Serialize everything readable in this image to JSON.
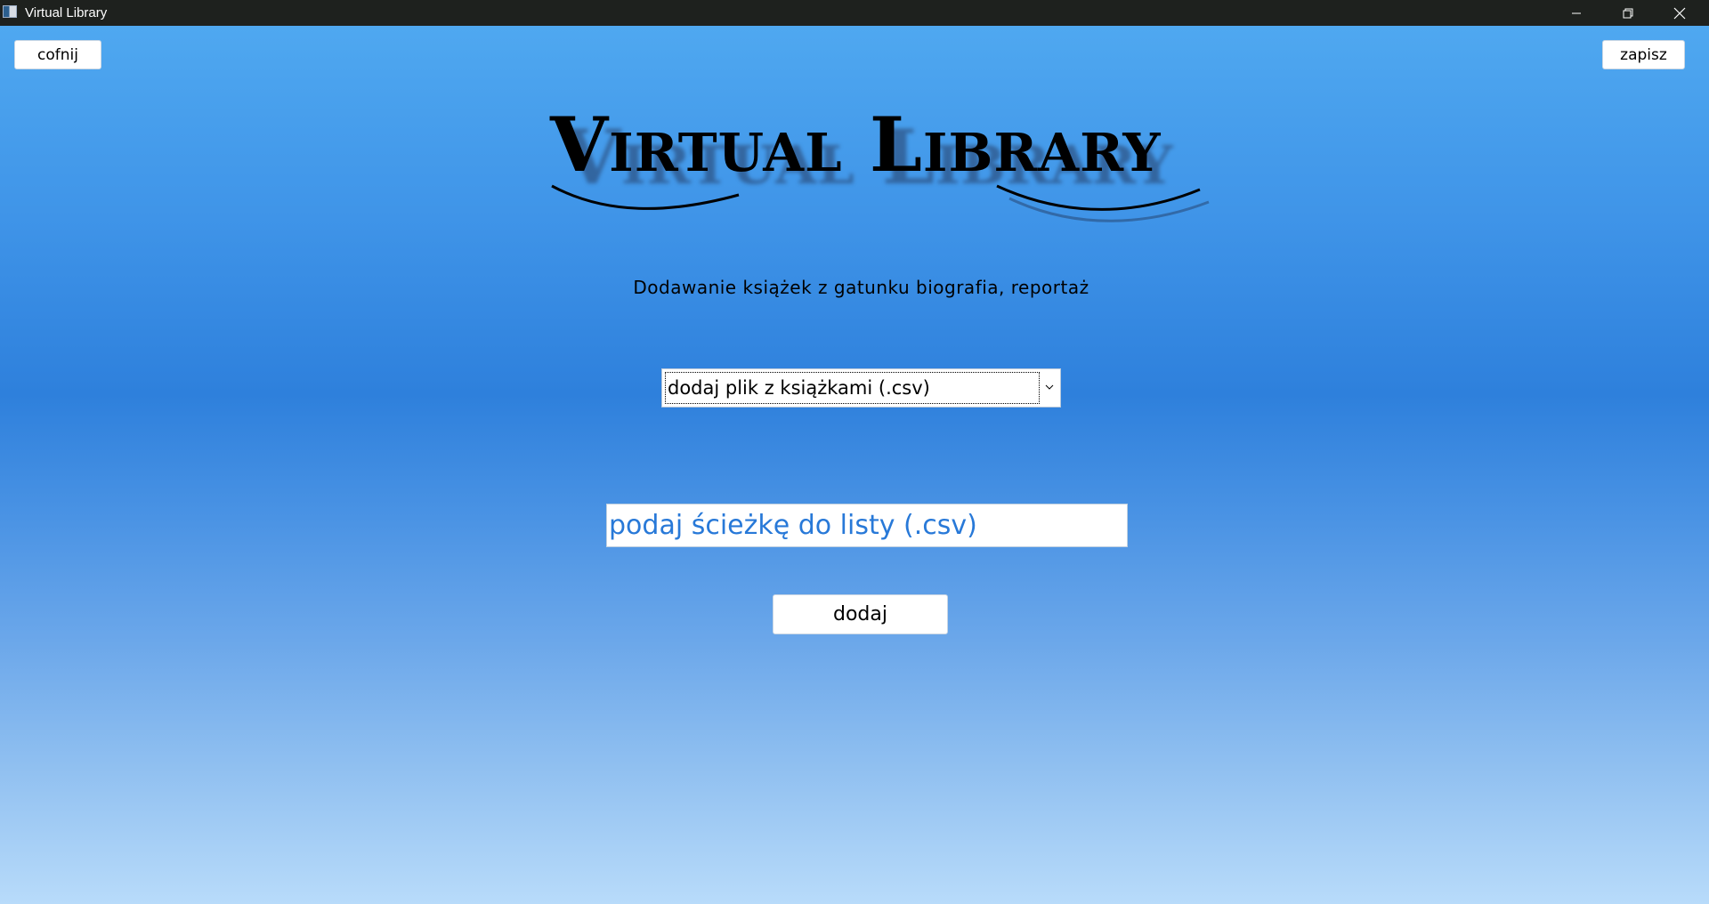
{
  "window": {
    "title": "Virtual Library",
    "controls": [
      "minimize-icon",
      "restore-icon",
      "close-icon"
    ]
  },
  "header": {
    "back_label": "cofnij",
    "save_label": "zapisz",
    "logo_text": "Virtual Library"
  },
  "main": {
    "subtitle": "Dodawanie książek z gatunku biografia, reportaż",
    "source_select": {
      "selected": "dodaj plik z książkami (.csv)"
    },
    "path_input": {
      "value": "",
      "placeholder": "podaj ścieżkę do listy (.csv)"
    },
    "add_label": "dodaj"
  },
  "colors": {
    "titlebar": "#1e211e",
    "gradient_top": "#4fa8f0",
    "gradient_mid": "#2e80dc",
    "gradient_bottom": "#b8dbfa",
    "placeholder_text": "#2879d8"
  }
}
